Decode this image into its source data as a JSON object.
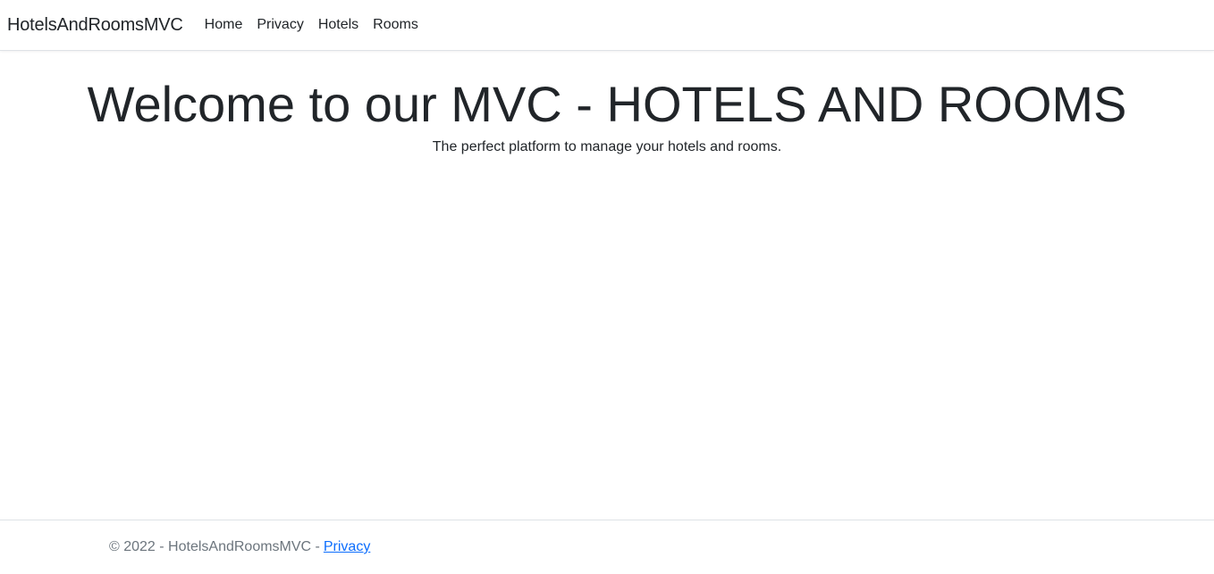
{
  "navbar": {
    "brand": "HotelsAndRoomsMVC",
    "links": [
      {
        "label": "Home"
      },
      {
        "label": "Privacy"
      },
      {
        "label": "Hotels"
      },
      {
        "label": "Rooms"
      }
    ]
  },
  "main": {
    "title": "Welcome to our MVC - HOTELS AND ROOMS",
    "subtitle": "The perfect platform to manage your hotels and rooms."
  },
  "footer": {
    "copyright": "© 2022 - HotelsAndRoomsMVC -",
    "privacy_link": "Privacy"
  },
  "colors": {
    "text": "#212529",
    "muted": "#6c757d",
    "link": "#0d6efd",
    "border": "#dee2e6"
  }
}
